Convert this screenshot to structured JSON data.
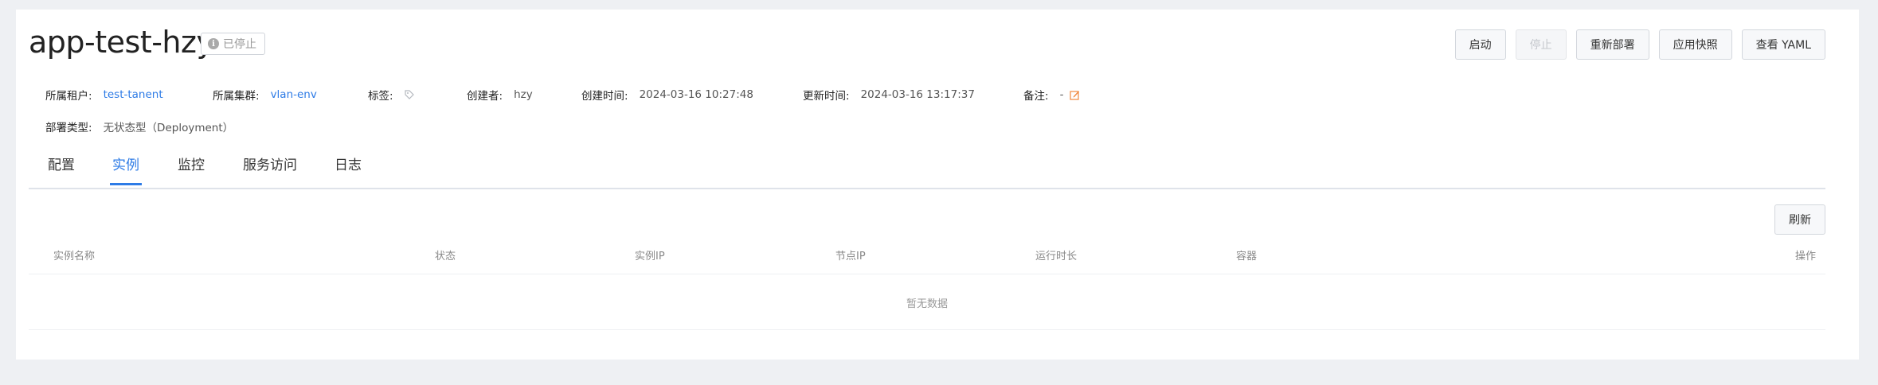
{
  "header": {
    "title": "app-test-hzy",
    "status": "已停止",
    "status_icon": "info-icon"
  },
  "actions": {
    "start": "启动",
    "stop": "停止",
    "redeploy": "重新部署",
    "snapshot": "应用快照",
    "view_yaml": "查看 YAML"
  },
  "meta": {
    "tenant_label": "所属租户:",
    "tenant_value": "test-tanent",
    "cluster_label": "所属集群:",
    "cluster_value": "vlan-env",
    "tags_label": "标签:",
    "creator_label": "创建者:",
    "creator_value": "hzy",
    "created_label": "创建时间:",
    "created_value": "2024-03-16 10:27:48",
    "updated_label": "更新时间:",
    "updated_value": "2024-03-16 13:17:37",
    "remark_label": "备注:",
    "remark_value": "-",
    "deploy_type_label": "部署类型:",
    "deploy_type_value": "无状态型（Deployment）"
  },
  "tabs": [
    {
      "label": "配置",
      "active": false
    },
    {
      "label": "实例",
      "active": true
    },
    {
      "label": "监控",
      "active": false
    },
    {
      "label": "服务访问",
      "active": false
    },
    {
      "label": "日志",
      "active": false
    }
  ],
  "table": {
    "refresh": "刷新",
    "columns": [
      "实例名称",
      "状态",
      "实例IP",
      "节点IP",
      "运行时长",
      "容器",
      "操作"
    ],
    "empty_text": "暂无数据"
  },
  "colors": {
    "accent": "#2d7be6",
    "edit_icon": "#f0883e",
    "background": "#eef0f3"
  }
}
